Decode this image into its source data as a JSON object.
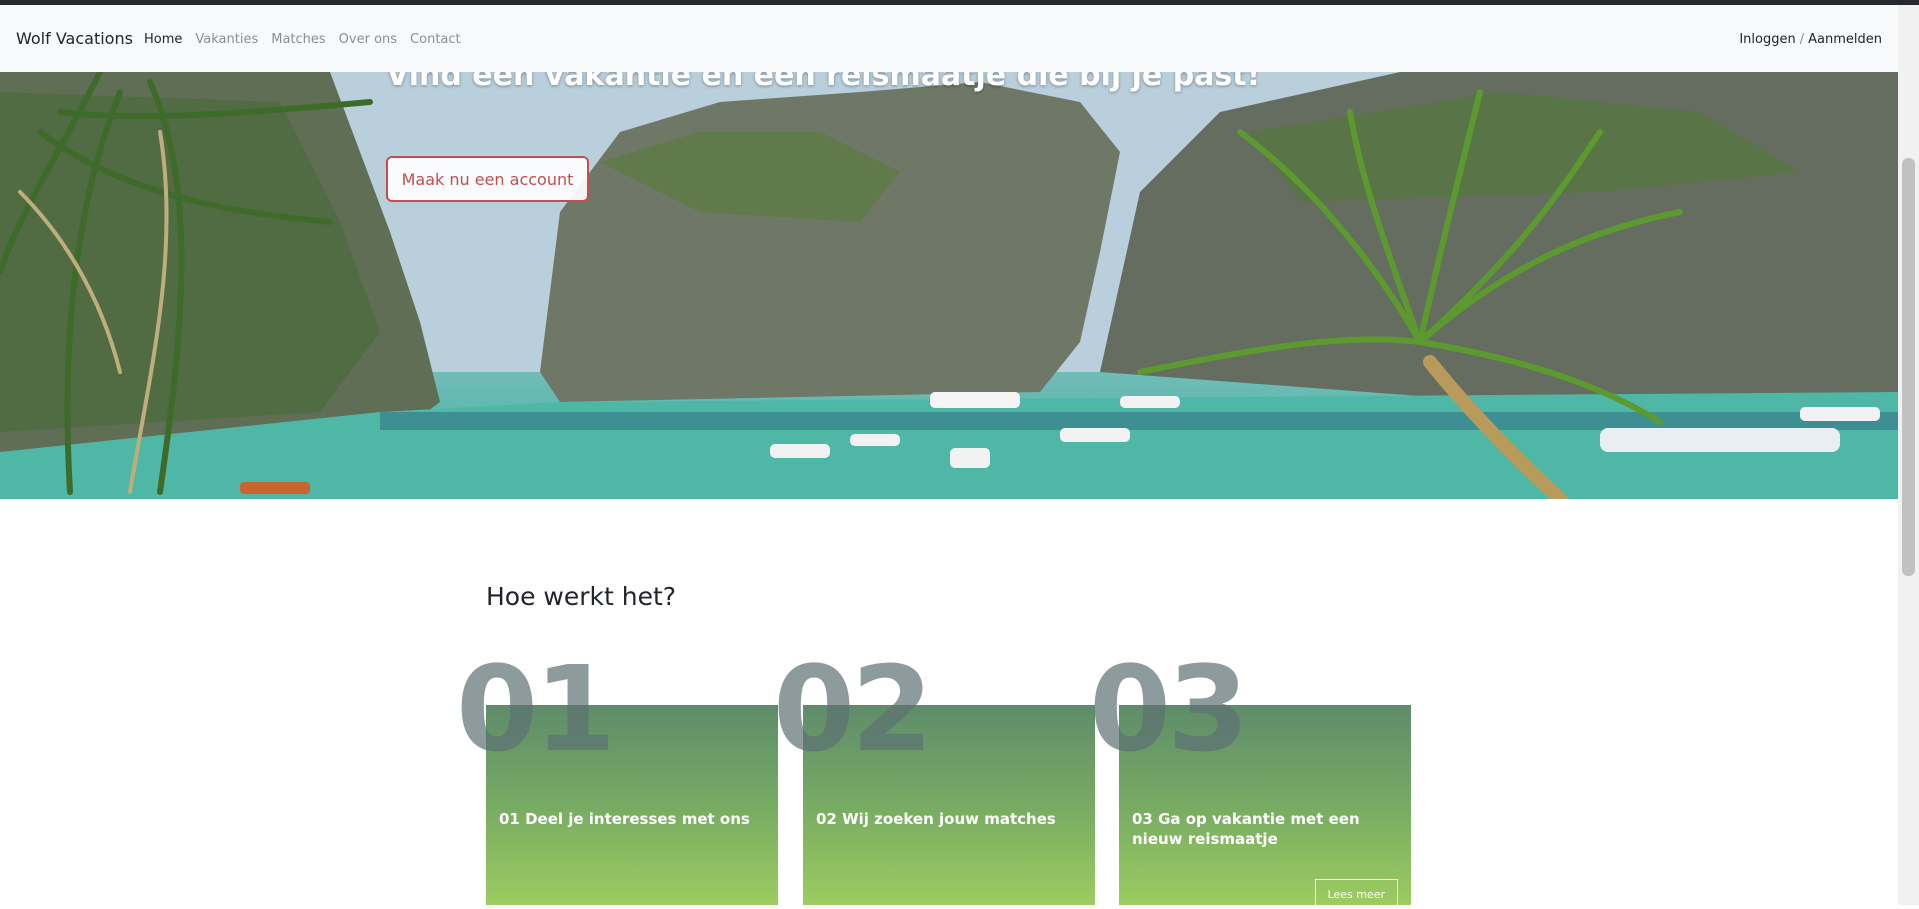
{
  "navbar": {
    "brand": "Wolf Vacations",
    "links": [
      "Home",
      "Vakanties",
      "Matches",
      "Over ons",
      "Contact"
    ],
    "login": "Inloggen",
    "separator": "/",
    "register": "Aanmelden"
  },
  "hero": {
    "title": "Vind een vakantie en een reismaatje die bij je past!",
    "button": "Maak nu een account"
  },
  "how": {
    "title": "Hoe werkt het?",
    "steps": [
      {
        "number": "01",
        "title": "01 Deel je interesses met ons"
      },
      {
        "number": "02",
        "title": "02 Wij zoeken jouw matches"
      },
      {
        "number": "03",
        "title": "03 Ga op vakantie met een nieuw reismaatje",
        "button": "Lees meer"
      }
    ]
  },
  "colors": {
    "accent": "#c0504d",
    "card_top": "#5e8c6a",
    "card_bottom": "#9dcc60"
  }
}
